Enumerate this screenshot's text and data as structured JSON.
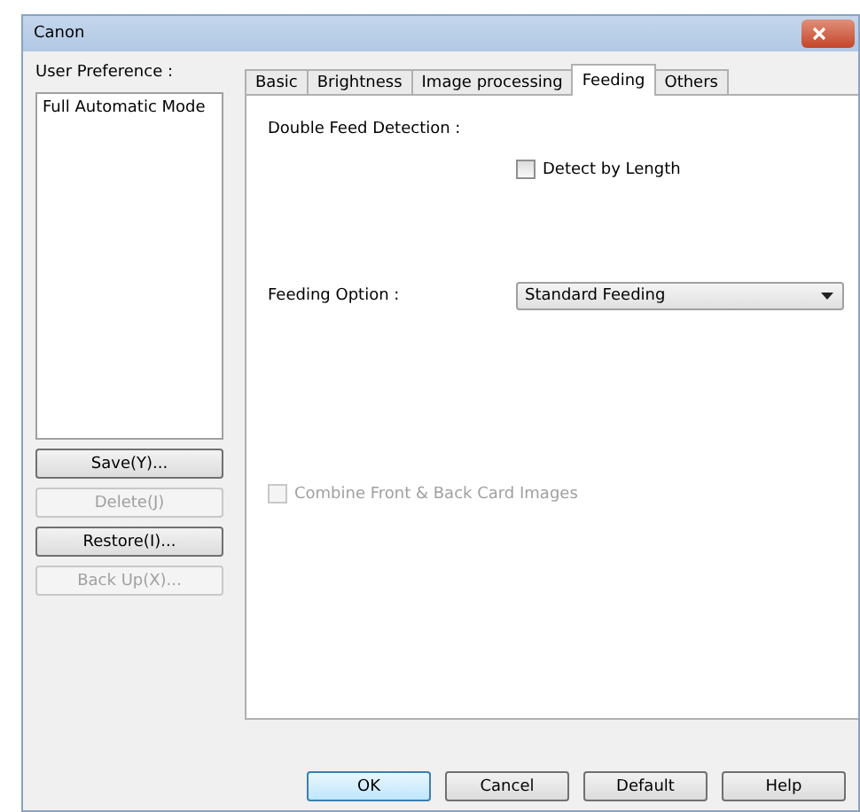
{
  "window": {
    "title": "Canon"
  },
  "user_preference": {
    "label": "User Preference :",
    "items": [
      {
        "label": "Full Automatic Mode",
        "selected": false
      }
    ],
    "buttons": [
      {
        "label": "Save(Y)...",
        "disabled": false
      },
      {
        "label": "Delete(J)",
        "disabled": true
      },
      {
        "label": "Restore(I)...",
        "disabled": false
      },
      {
        "label": "Back Up(X)...",
        "disabled": true
      }
    ]
  },
  "tabs": [
    {
      "label": "Basic",
      "selected": false
    },
    {
      "label": "Brightness",
      "selected": false
    },
    {
      "label": "Image processing",
      "selected": false
    },
    {
      "label": "Feeding",
      "selected": true
    },
    {
      "label": "Others",
      "selected": false
    }
  ],
  "feeding": {
    "double_feed_label": "Double Feed Detection :",
    "detect_by_length": {
      "label": "Detect by Length",
      "checked": false,
      "disabled": false
    },
    "feeding_option": {
      "label": "Feeding Option :",
      "value": "Standard Feeding"
    },
    "combine_cards": {
      "label": "Combine Front & Back Card Images",
      "checked": false,
      "disabled": true
    }
  },
  "buttons": [
    {
      "label": "OK",
      "default": true
    },
    {
      "label": "Cancel",
      "default": false
    },
    {
      "label": "Default",
      "default": false
    },
    {
      "label": "Help",
      "default": false
    }
  ]
}
